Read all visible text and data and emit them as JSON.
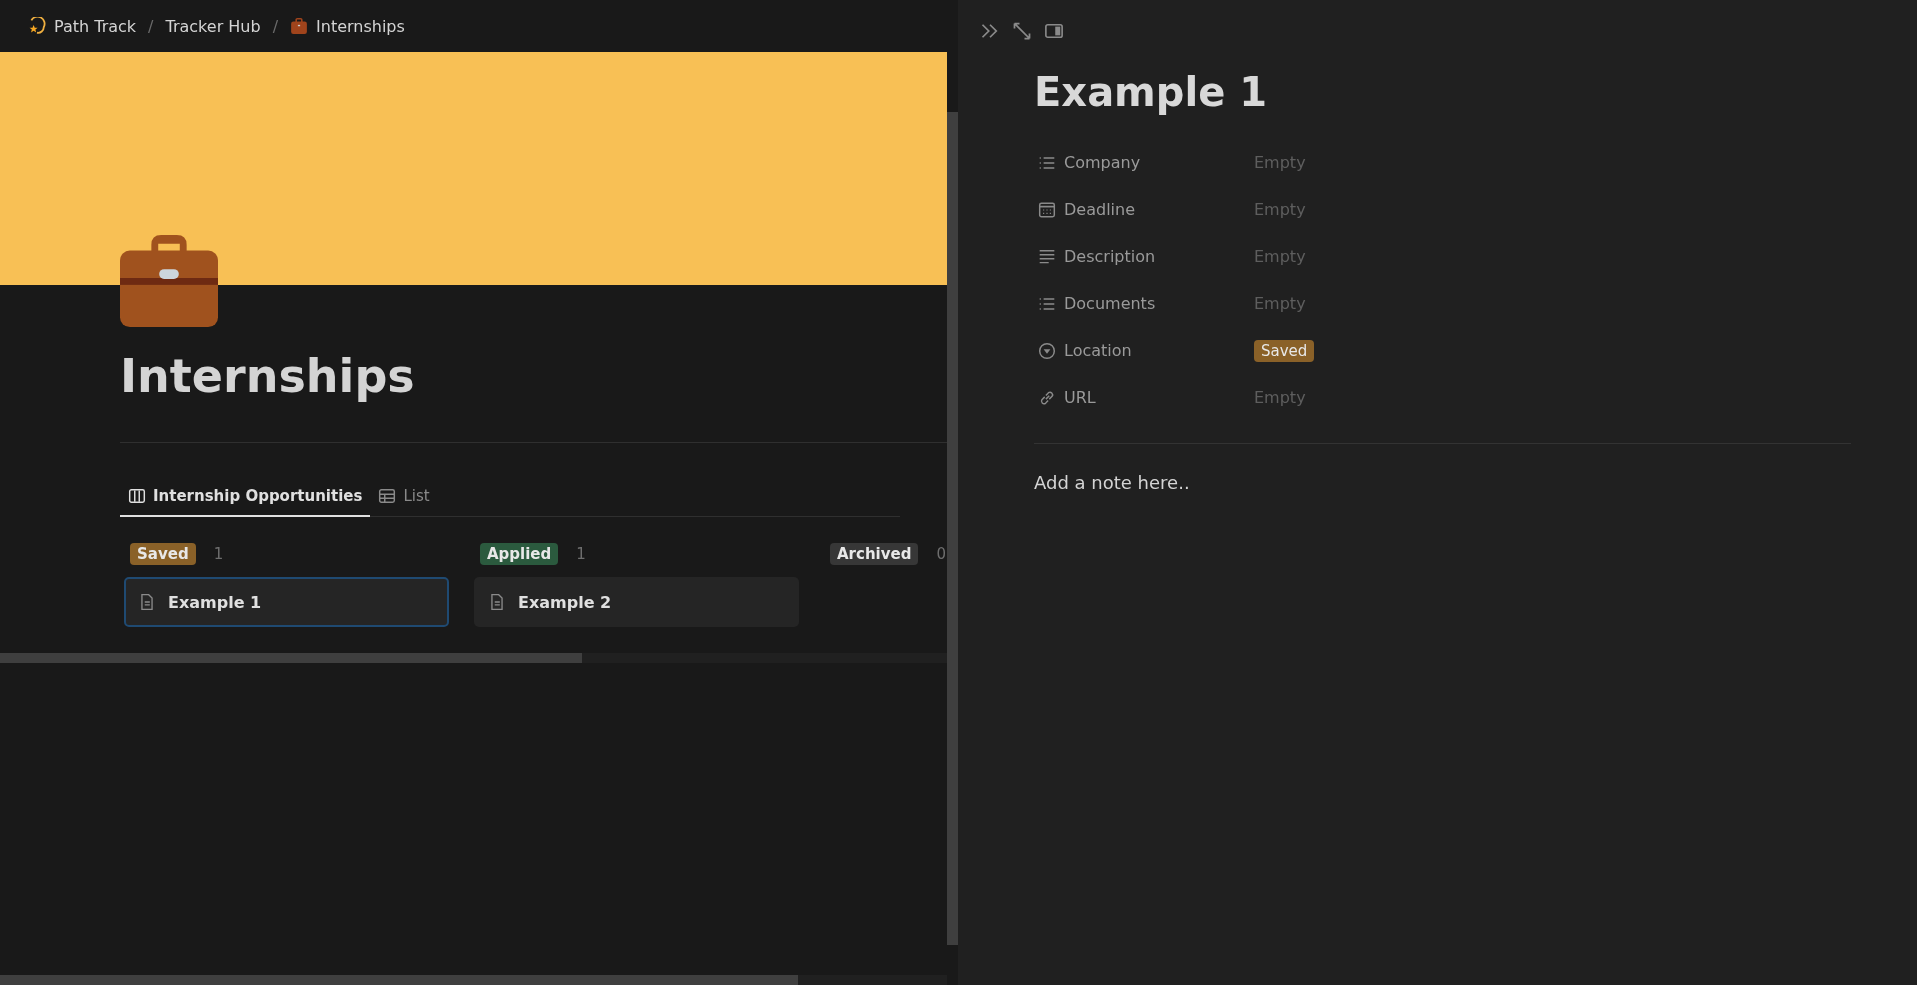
{
  "breadcrumb": [
    {
      "label": "Path Track",
      "kind": "star"
    },
    {
      "separator": "/",
      "label": "Tracker Hub",
      "kind": "plain"
    },
    {
      "separator": "/",
      "label": "Internships",
      "kind": "briefcase"
    }
  ],
  "page": {
    "title": "Internships"
  },
  "tabs": [
    {
      "label": "Internship Opportunities",
      "kind": "board",
      "selected": true
    },
    {
      "label": "List",
      "kind": "table",
      "selected": false
    }
  ],
  "board": {
    "columns": [
      {
        "tag": "Saved",
        "color": "#8a6128",
        "count": "1",
        "cards": [
          {
            "title": "Example 1",
            "selected": true
          }
        ]
      },
      {
        "tag": "Applied",
        "color": "#2b5a3e",
        "count": "1",
        "cards": [
          {
            "title": "Example 2",
            "selected": false
          }
        ]
      },
      {
        "tag": "Archived",
        "color": "#373737",
        "count": "0"
      }
    ]
  },
  "detail": {
    "title": "Example 1",
    "properties": [
      {
        "kind": "multi",
        "label": "Company",
        "value": "Empty"
      },
      {
        "kind": "date",
        "label": "Deadline",
        "value": "Empty"
      },
      {
        "kind": "text",
        "label": "Description",
        "value": "Empty"
      },
      {
        "kind": "multi",
        "label": "Documents",
        "value": "Empty"
      },
      {
        "kind": "select",
        "label": "Location",
        "value": "Saved",
        "color": "#8a6128"
      },
      {
        "kind": "url",
        "label": "URL",
        "value": "Empty"
      }
    ],
    "note": "Add a note here.."
  }
}
